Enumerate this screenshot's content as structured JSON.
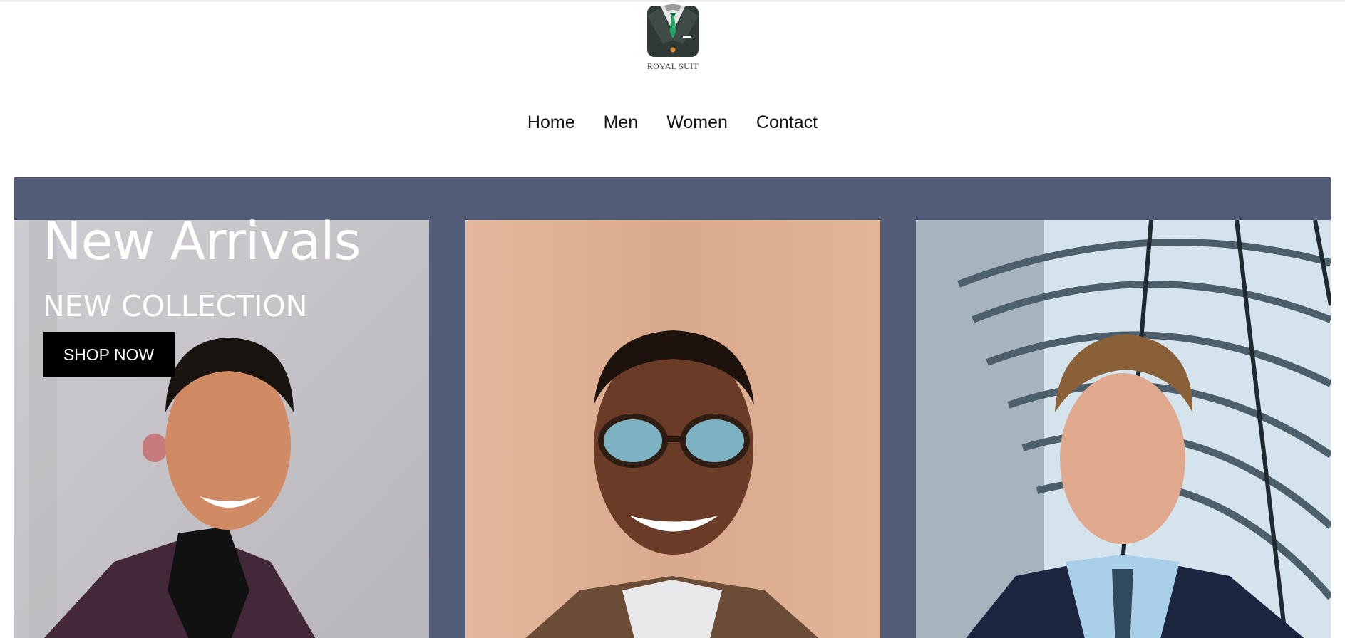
{
  "brand": {
    "name": "ROYAL SUIT",
    "logo_icon": "suit-jacket-icon"
  },
  "nav": {
    "items": [
      {
        "label": "Home"
      },
      {
        "label": "Men"
      },
      {
        "label": "Women"
      },
      {
        "label": "Contact"
      }
    ]
  },
  "hero": {
    "title": "New Arrivals",
    "subtitle": "NEW COLLECTION",
    "cta_label": "SHOP NOW",
    "background_color": "#525c77"
  },
  "colors": {
    "cta_background": "#000000",
    "nav_text": "#111111"
  }
}
